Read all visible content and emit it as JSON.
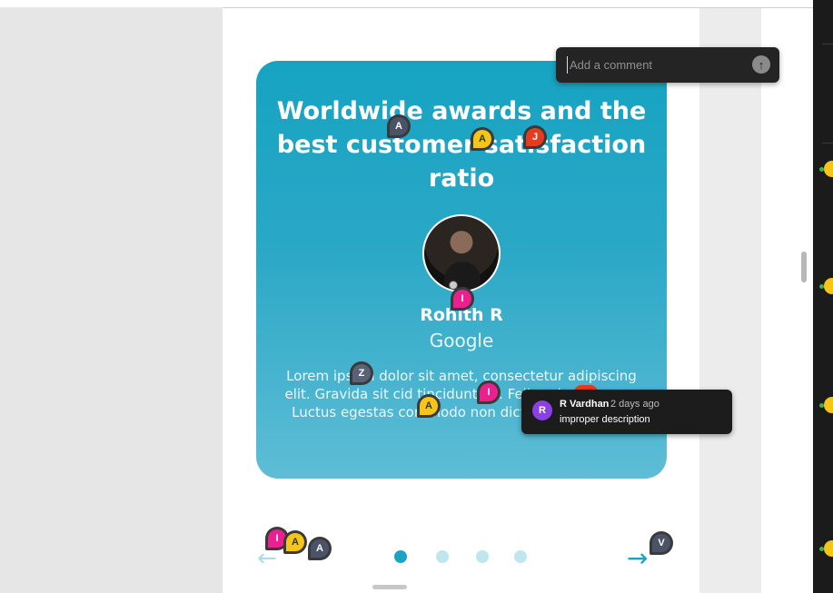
{
  "card": {
    "title": "Worldwide awards and the best customer satisfaction ratio",
    "person_name": "Rohith R",
    "company": "Google",
    "description": "Lorem ipsum dolor sit amet, consectetur adipiscing elit. Gravida sit cid tincidunt eu. Felis sol, ac lacus e Luctus egestas commodo non dictumst eget nisi ."
  },
  "comment_input": {
    "placeholder": "Add a comment"
  },
  "comment_popup": {
    "author_initial": "R",
    "author": "R Vardhan",
    "time": "2 days ago",
    "text": "improper description"
  },
  "pins": {
    "p1": "A",
    "p2": "A",
    "p3": "J",
    "p4": "I",
    "p5": "Z",
    "p6": "A",
    "p7": "I",
    "p8": "I",
    "p9": "A",
    "p10": "A",
    "p11": "V"
  },
  "carousel": {
    "slide_count": 4,
    "active_index": 0
  },
  "colors": {
    "accent": "#1aa3c2",
    "pin_dark": "#4b5368",
    "pin_yellow": "#f5c518",
    "pin_red": "#e63b1e",
    "pin_pink": "#ec1f8e",
    "popup_avatar": "#8b3fe6"
  },
  "icons": {
    "send": "arrow-up-icon",
    "prev": "arrow-left-icon",
    "next": "arrow-right-icon"
  }
}
